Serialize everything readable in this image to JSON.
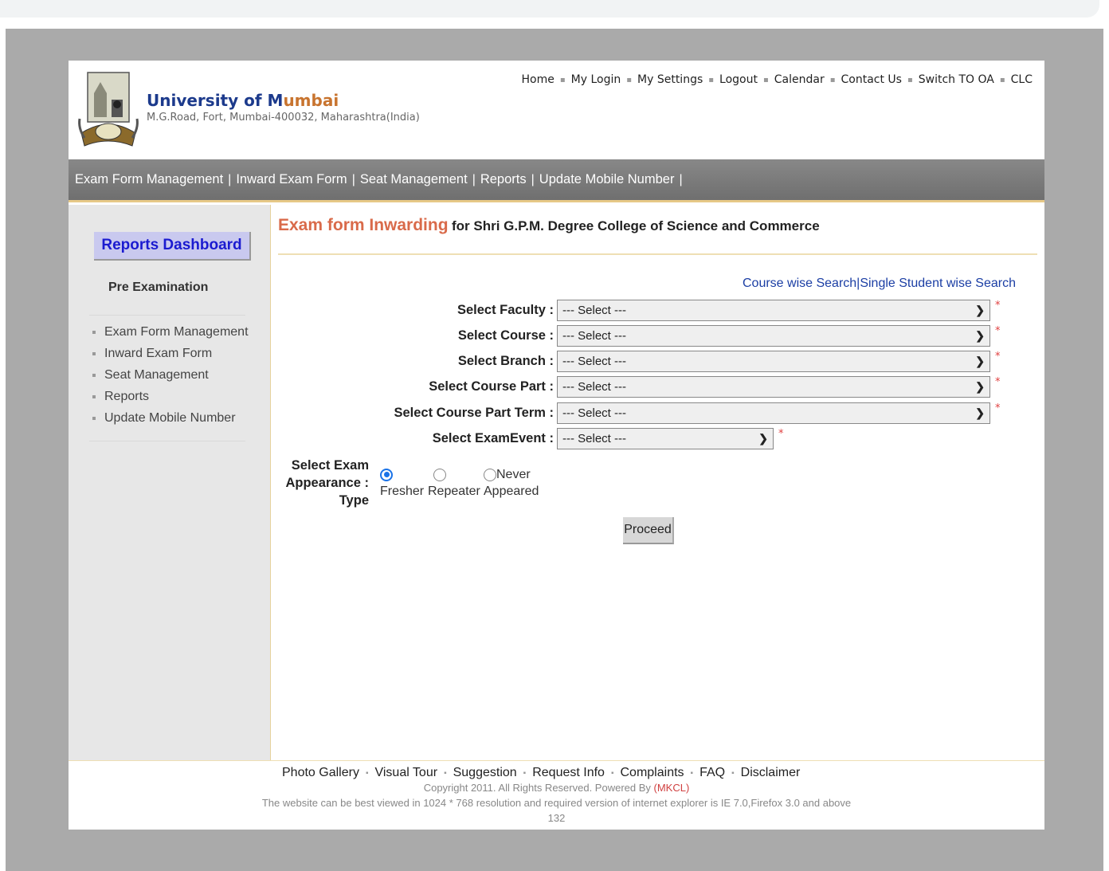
{
  "header": {
    "title_part1": "University of M",
    "title_part2": "umbai",
    "address": "M.G.Road, Fort, Mumbai-400032, Maharashtra(India)",
    "top_links": [
      "Home",
      "My Login",
      "My Settings",
      "Logout",
      "Calendar",
      "Contact Us",
      "Switch TO OA",
      "CLC"
    ]
  },
  "navbar": {
    "items": [
      "Exam Form Management",
      "Inward Exam Form",
      "Seat Management",
      "Reports",
      "Update Mobile Number"
    ],
    "separator": "|"
  },
  "sidebar": {
    "dashboard_label": "Reports Dashboard",
    "section_title": "Pre Examination",
    "items": [
      "Exam Form Management",
      "Inward Exam Form",
      "Seat Management",
      "Reports",
      "Update Mobile Number"
    ]
  },
  "main": {
    "title": "Exam form Inwarding",
    "subtitle": "for Shri G.P.M. Degree College of Science and Commerce",
    "search_links": {
      "course": "Course wise Search",
      "separator": "|",
      "student": "Single Student wise Search"
    },
    "form": {
      "fields": [
        {
          "label": "Select Faculty :",
          "value": "--- Select ---"
        },
        {
          "label": "Select Course :",
          "value": "--- Select ---"
        },
        {
          "label": "Select Branch :",
          "value": "--- Select ---"
        },
        {
          "label": "Select Course Part :",
          "value": "--- Select ---"
        },
        {
          "label": "Select Course Part Term :",
          "value": "--- Select ---"
        },
        {
          "label": "Select ExamEvent :",
          "value": "--- Select ---"
        }
      ],
      "required_mark": "*",
      "appearance": {
        "label_lines": [
          "Select Exam",
          "Appearance :",
          "Type"
        ],
        "options": [
          {
            "label": "Fresher",
            "selected": true
          },
          {
            "label": "Repeater",
            "selected": false
          },
          {
            "label_lines": [
              "Never",
              "Appeared"
            ],
            "selected": false
          }
        ]
      },
      "proceed_label": "Proceed"
    }
  },
  "footer": {
    "links": [
      "Photo Gallery",
      "Visual Tour",
      "Suggestion",
      "Request Info",
      "Complaints",
      "FAQ",
      "Disclaimer"
    ],
    "copyright_prefix": "Copyright 2011. All Rights Reserved. Powered By ",
    "powered_by": "(MKCL)",
    "note": "The website can be best viewed in 1024 * 768 resolution and required version of internet explorer is IE 7.0,Firefox 3.0 and above",
    "counter": "132"
  },
  "colors": {
    "brand_orange": "#c8742f",
    "brand_blue": "#1c3a8c",
    "title_orange": "#d96a4a",
    "link_blue": "#1b3ea4",
    "required_red": "#e04040",
    "radio_blue": "#1a73e8"
  }
}
